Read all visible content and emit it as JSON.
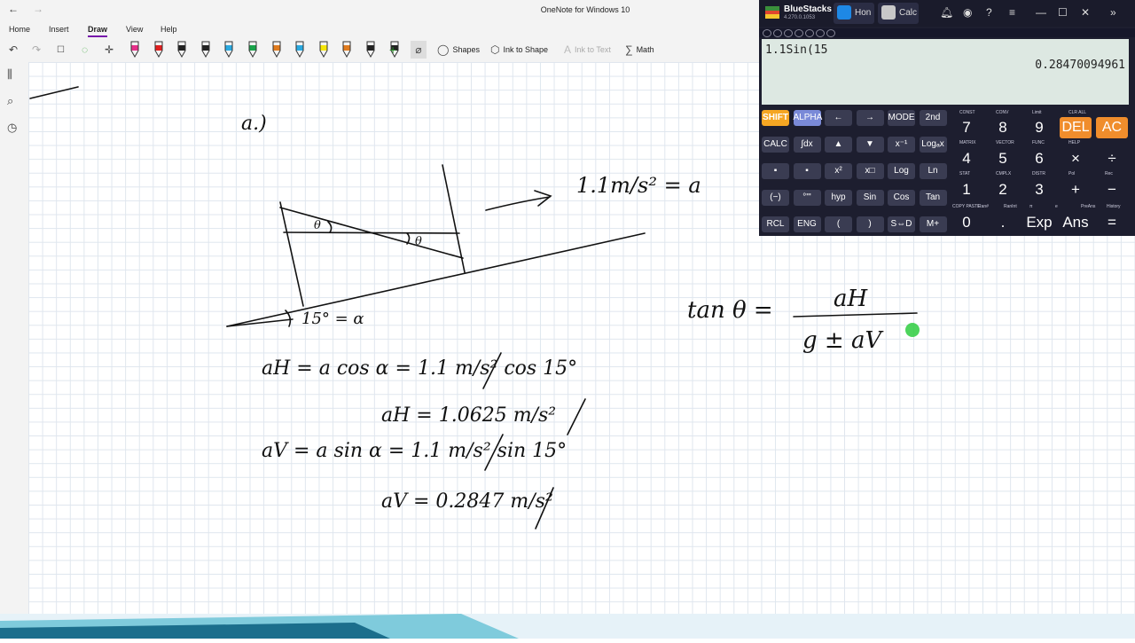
{
  "window": {
    "title": "OneNote for Windows 10"
  },
  "menu": {
    "items": [
      "Home",
      "Insert",
      "Draw",
      "View",
      "Help"
    ],
    "active": "Draw"
  },
  "toolbar": {
    "shapes_label": "Shapes",
    "ink_to_shape_label": "Ink to Shape",
    "ink_to_text_label": "Ink to Text",
    "math_label": "Math",
    "pen_colors": [
      "#e6308a",
      "#e02020",
      "#222222",
      "#222222",
      "#2aa9e0",
      "#19a34a",
      "#e07b1e",
      "#2aa9e0",
      "#f5e50a",
      "#e07b1e",
      "#222222",
      "#222222"
    ]
  },
  "notes": {
    "part_label": "a.)",
    "accel_note": "1.1m/s² = a",
    "theta_label": "θ",
    "alpha_label": "15° = α",
    "tan_lhs": "tan θ =",
    "tan_num": "aH",
    "tan_den": "g ± aV",
    "eq1": "aH = a cos α = 1.1 m/s² cos 15°",
    "eq2": "aH = 1.0625 m/s²",
    "eq3": "aV = a sin α = 1.1 m/s² sin 15°",
    "eq4": "aV = 0.2847 m/s²"
  },
  "bluestacks": {
    "name": "BlueStacks",
    "version": "4.270.0.1053",
    "tabs": [
      "Hon",
      "Calc"
    ]
  },
  "calculator": {
    "input": "1.1Sin(15",
    "result": "0.28470094961",
    "row1": [
      "SHIFT",
      "ALPHA",
      "←",
      "→",
      "MODE",
      "2nd"
    ],
    "row2": [
      "CALC",
      "∫dx",
      "▲",
      "▼",
      "x⁻¹",
      "Logₐx"
    ],
    "row3": [
      "▪",
      "▪",
      "x²",
      "x□",
      "Log",
      "Ln"
    ],
    "row4": [
      "(−)",
      "°'\"",
      "hyp",
      "Sin",
      "Cos",
      "Tan"
    ],
    "row5": [
      "RCL",
      "ENG",
      "(",
      ")",
      "S⇔D",
      "M+"
    ],
    "num_row1": [
      "7",
      "8",
      "9",
      "DEL",
      "AC"
    ],
    "num_row2": [
      "4",
      "5",
      "6",
      "×",
      "÷"
    ],
    "num_row3": [
      "1",
      "2",
      "3",
      "+",
      "−"
    ],
    "num_row4": [
      "0",
      ".",
      "Exp",
      "Ans",
      "="
    ],
    "small_labels_top": [
      "CONST",
      "CONV",
      "Limit",
      "CLR ALL"
    ],
    "small_labels_mid": [
      "MATRIX",
      "VECTOR",
      "FUNC",
      "HELP"
    ],
    "small_labels_stat": [
      "STAT",
      "CMPLX",
      "DISTR",
      "Pol",
      "Rec"
    ],
    "small_labels_bottom": [
      "COPY PASTE",
      "Ran#",
      "RanInt",
      "π",
      "e",
      "PreAns",
      "History"
    ]
  }
}
